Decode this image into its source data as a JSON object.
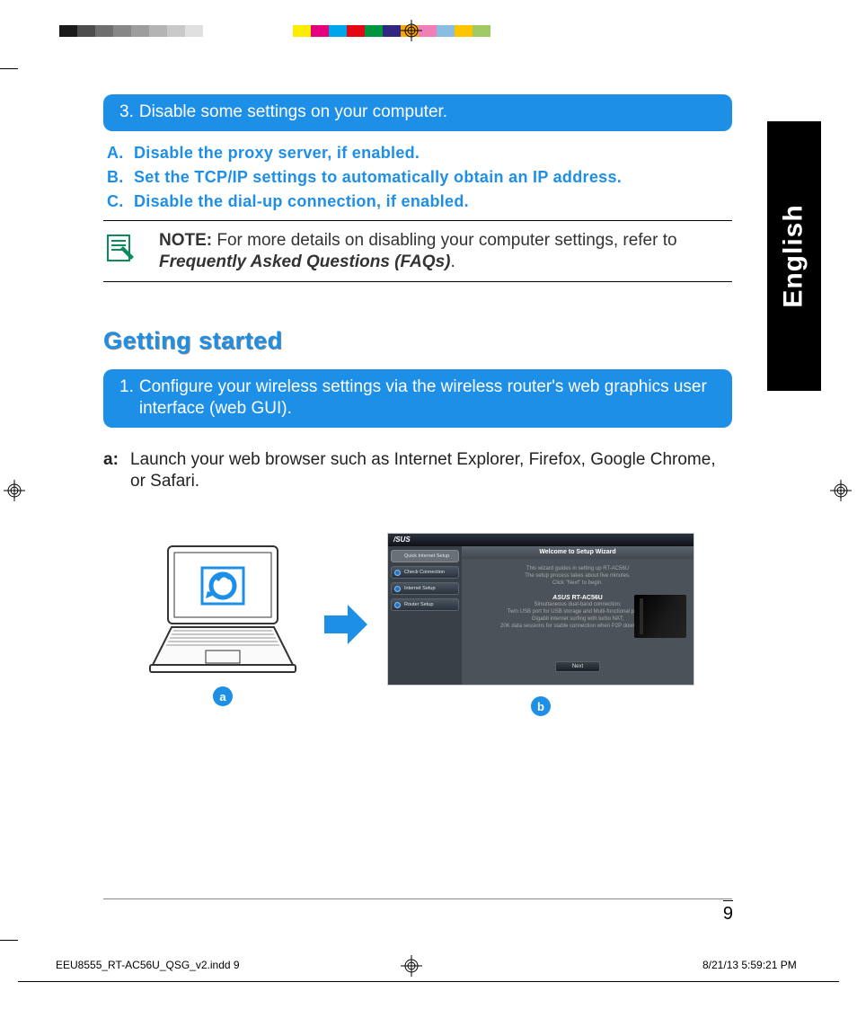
{
  "color_chips": [
    "#1a1a1a",
    "#4d4d4d",
    "#6f6f6f",
    "#878787",
    "#9d9d9d",
    "#b4b4b4",
    "#c9c9c9",
    "#e0e0e0",
    "#ffffff",
    "_gap",
    "#ffffff",
    "#fcec00",
    "#e5007e",
    "#00a6eb",
    "#e30613",
    "#009640",
    "#312783",
    "#f6a800",
    "#ef7fb6",
    "#8abee1",
    "#fdc500",
    "#a0c863"
  ],
  "lang_tab": "English",
  "step3": {
    "num": "3.",
    "text": "Disable some settings on your computer."
  },
  "sub": {
    "a": {
      "label": "A.",
      "text": "Disable the proxy server, if enabled."
    },
    "b": {
      "label": "B.",
      "text": "Set the TCP/IP settings to automatically obtain an IP address."
    },
    "c": {
      "label": "C.",
      "text": "Disable the dial-up connection, if enabled."
    }
  },
  "note": {
    "label": "NOTE:",
    "body": " For more details on disabling your computer settings, refer to ",
    "faq": "Frequently Asked Questions (FAQs)",
    "tail": "."
  },
  "section": "Getting started",
  "step1": {
    "num": "1.",
    "text": "Configure your wireless settings via the wireless router's web graphics user interface (web GUI)."
  },
  "step_a": {
    "label": "a:",
    "text": "Launch your web browser such as Internet  Explorer, Firefox, Google Chrome, or Safari."
  },
  "badge_a": "a",
  "badge_b": "b",
  "wizard": {
    "header": "Welcome to Setup Wizard",
    "line1a": "This wizard guides in setting up ",
    "line1b": "RT-AC56U",
    "line2": "The setup process takes about five minutes.",
    "line3": "Click \"Next\" to begin.",
    "brand": "ASUS",
    "model": "RT-AC56U",
    "feat1": "Simultaneous dual-band connection;",
    "feat2": "Twin USB port for USB storage and Multi-functional printer;",
    "feat3": "Gigabit internet surfing with turbo NAT;",
    "feat4": "20K data sessions for stable connection when P2P downloading.",
    "next": "Next",
    "nav": [
      "Quick Internet Setup",
      "Check Connection",
      "Internet Setup",
      "Router Setup"
    ]
  },
  "page_num": "9",
  "footer_left": "EEU8555_RT-AC56U_QSG_v2.indd   9",
  "footer_right": "8/21/13   5:59:21 PM"
}
